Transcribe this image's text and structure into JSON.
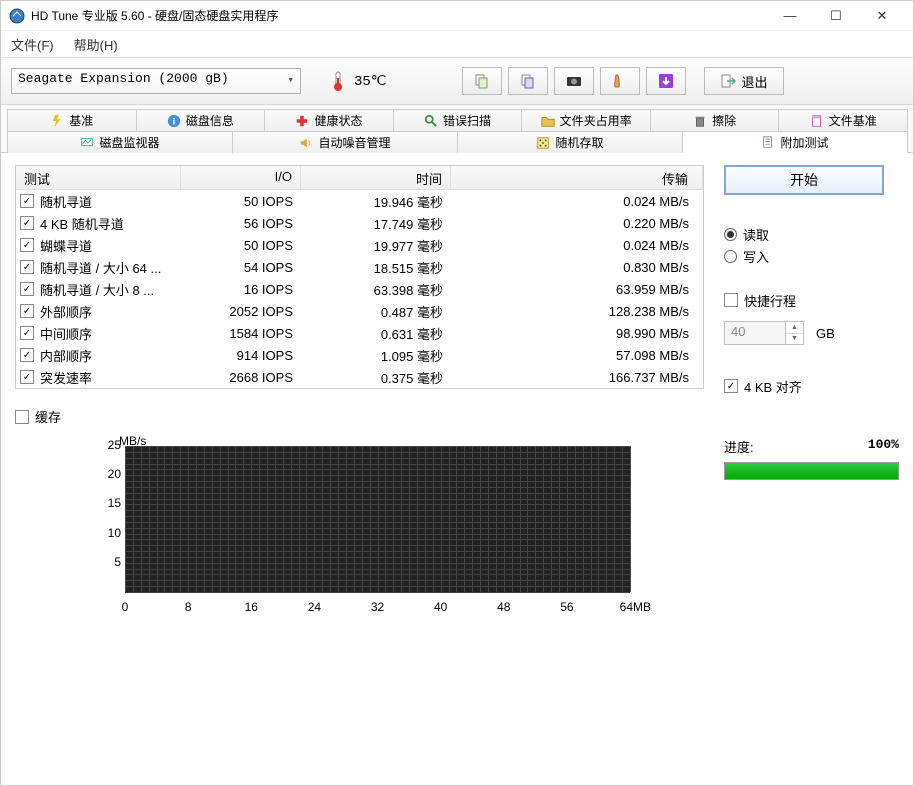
{
  "window_title": "HD Tune 专业版 5.60 - 硬盘/固态硬盘实用程序",
  "menu": {
    "file": "文件(F)",
    "help": "帮助(H)"
  },
  "drive": "Seagate Expansion (2000 gB)",
  "temperature": "35℃",
  "exit_label": "退出",
  "tabs_row1": [
    {
      "label": "基准",
      "icon": "bolt"
    },
    {
      "label": "磁盘信息",
      "icon": "info"
    },
    {
      "label": "健康状态",
      "icon": "plus"
    },
    {
      "label": "错误扫描",
      "icon": "search"
    },
    {
      "label": "文件夹占用率",
      "icon": "folder"
    },
    {
      "label": "擦除",
      "icon": "trash"
    },
    {
      "label": "文件基准",
      "icon": "file"
    }
  ],
  "tabs_row2": [
    {
      "label": "磁盘监视器",
      "icon": "monitor"
    },
    {
      "label": "自动噪音管理",
      "icon": "sound"
    },
    {
      "label": "随机存取",
      "icon": "random"
    },
    {
      "label": "附加测试",
      "icon": "extra",
      "active": true
    }
  ],
  "table": {
    "headers": {
      "test": "测试",
      "io": "I/O",
      "time": "时间",
      "tx": "传输"
    },
    "rows": [
      {
        "name": "随机寻道",
        "io": "50 IOPS",
        "time": "19.946 毫秒",
        "tx": "0.024 MB/s"
      },
      {
        "name": "4 KB 随机寻道",
        "io": "56 IOPS",
        "time": "17.749 毫秒",
        "tx": "0.220 MB/s"
      },
      {
        "name": "蝴蝶寻道",
        "io": "50 IOPS",
        "time": "19.977 毫秒",
        "tx": "0.024 MB/s"
      },
      {
        "name": "随机寻道 / 大小 64 ...",
        "io": "54 IOPS",
        "time": "18.515 毫秒",
        "tx": "0.830 MB/s"
      },
      {
        "name": "随机寻道 / 大小 8 ...",
        "io": "16 IOPS",
        "time": "63.398 毫秒",
        "tx": "63.959 MB/s"
      },
      {
        "name": "外部顺序",
        "io": "2052 IOPS",
        "time": "0.487 毫秒",
        "tx": "128.238 MB/s"
      },
      {
        "name": "中间顺序",
        "io": "1584 IOPS",
        "time": "0.631 毫秒",
        "tx": "98.990 MB/s"
      },
      {
        "name": "内部顺序",
        "io": "914 IOPS",
        "time": "1.095 毫秒",
        "tx": "57.098 MB/s"
      },
      {
        "name": "突发速率",
        "io": "2668 IOPS",
        "time": "0.375 毫秒",
        "tx": "166.737 MB/s"
      }
    ]
  },
  "cache_label": "缓存",
  "start_label": "开始",
  "radio": {
    "read": "读取",
    "write": "写入"
  },
  "quick_path_label": "快捷行程",
  "size_value": "40",
  "size_unit": "GB",
  "align_label": "4 KB 对齐",
  "progress": {
    "label": "进度:",
    "value": "100%"
  },
  "chart_data": {
    "type": "line",
    "title": "",
    "x": [],
    "series": [],
    "y_unit": "MB/s",
    "y_ticks": [
      5,
      10,
      15,
      20,
      25
    ],
    "x_ticks": [
      0,
      8,
      16,
      24,
      32,
      40,
      48,
      56
    ],
    "x_max_label": "64MB",
    "xlim": [
      0,
      64
    ],
    "ylim": [
      0,
      25
    ]
  }
}
